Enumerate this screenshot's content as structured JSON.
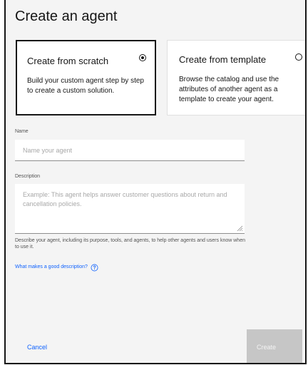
{
  "dialog": {
    "title": "Create an agent"
  },
  "options": {
    "scratch": {
      "title": "Create from scratch",
      "description": "Build your custom agent step by step to create a custom solution.",
      "selected": true
    },
    "template": {
      "title": "Create from template",
      "description": "Browse the catalog and use the attributes of another agent as a template to create your agent.",
      "selected": false
    }
  },
  "form": {
    "name": {
      "label": "Name",
      "placeholder": "Name your agent",
      "value": ""
    },
    "description": {
      "label": "Description",
      "placeholder": "Example: This agent helps answer customer questions about return and cancellation policies.",
      "value": "",
      "helper": "Describe your agent, including its purpose, tools, and agents, to help other agents and users know when to use it."
    },
    "help_link": {
      "label": "What makes a good description?",
      "icon": "help-icon"
    }
  },
  "footer": {
    "cancel_label": "Cancel",
    "create_label": "Create"
  },
  "colors": {
    "accent": "#0f62fe",
    "background": "#f4f4f4",
    "disabled": "#c6c6c6"
  }
}
